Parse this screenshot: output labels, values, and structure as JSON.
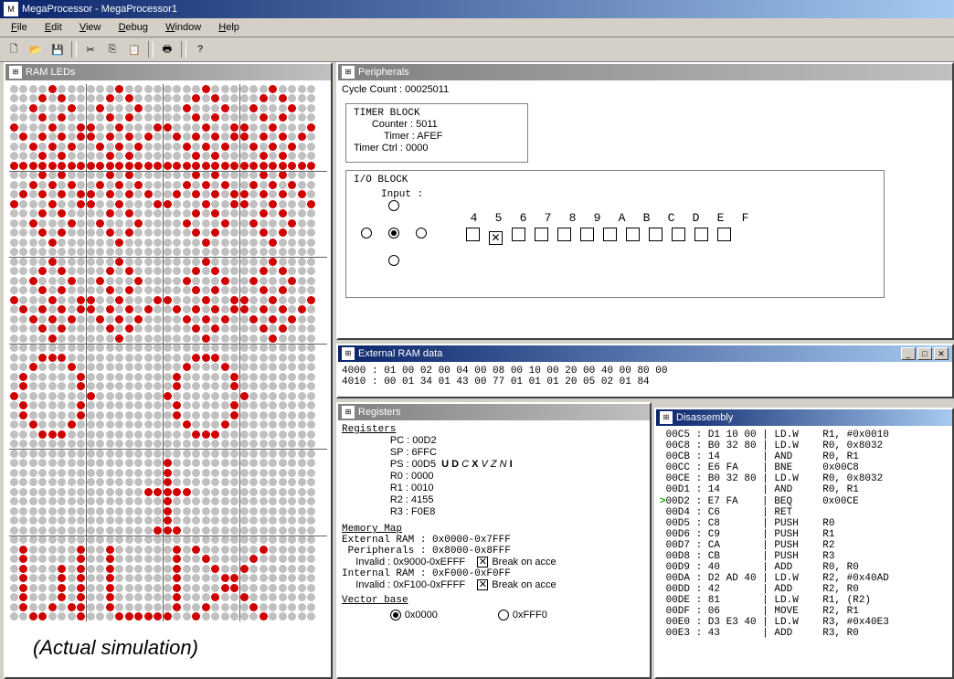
{
  "title": "MegaProcessor - MegaProcessor1",
  "menu": [
    "File",
    "Edit",
    "View",
    "Debug",
    "Window",
    "Help"
  ],
  "panels": {
    "ramleds": "RAM LEDs",
    "peripherals": "Peripherals",
    "extram": "External RAM data",
    "registers": "Registers",
    "disasm": "Disassembly"
  },
  "caption": "(Actual simulation)",
  "peripherals": {
    "cycle_label": "Cycle Count : ",
    "cycle_value": "00025011",
    "timer_block_title": "TIMER BLOCK",
    "counter_label": "Counter : ",
    "counter_value": "5011",
    "timer_label": "Timer : ",
    "timer_value": "AFEF",
    "timerctrl_label": "Timer Ctrl : ",
    "timerctrl_value": "0000",
    "io_block_title": "I/O BLOCK",
    "input_label": "Input : ",
    "bit_labels": [
      "4",
      "5",
      "6",
      "7",
      "8",
      "9",
      "A",
      "B",
      "C",
      "D",
      "E",
      "F"
    ],
    "bit_checked_index": 1
  },
  "extram": {
    "line1": "4000 : 01 00 02 00 04 00 08 00 10 00 20 00 40 00 80 00",
    "line2": "4010 : 00 01 34 01 43 00 77 01 01 01 20 05 02 01 84"
  },
  "registers": {
    "heading": "Registers",
    "pc": "PC : 00D2",
    "sp": "SP : 6FFC",
    "ps": "PS : 00D5  ",
    "flags": "U D C X V Z N I",
    "flags_bold": [
      0,
      1,
      3,
      7
    ],
    "r0": "R0 : 0000",
    "r1": "R1 : 0010",
    "r2": "R2 : 4155",
    "r3": "R3 : F0E8",
    "memmap_heading": "Memory Map",
    "extram": "External RAM : 0x0000-0x7FFF",
    "periph": " Peripherals : 0x8000-0x8FFF",
    "inval1": "     Invalid : 0x9000-0xEFFF",
    "intram": "Internal RAM : 0xF000-0xF0FF",
    "inval2": "     Invalid : 0xF100-0xFFFF",
    "break1": "Break on acce",
    "break2": "Break on acce",
    "vecbase": "Vector base",
    "vb_opt1": "0x0000",
    "vb_opt2": "0xFFF0"
  },
  "disasm": {
    "lines": [
      {
        "a": "00C5",
        "b": "D1 10 00",
        "op": "LD.W",
        "args": "R1, #0x0010"
      },
      {
        "a": "00C8",
        "b": "B0 32 80",
        "op": "LD.W",
        "args": "R0, 0x8032"
      },
      {
        "a": "00CB",
        "b": "14",
        "op": "AND",
        "args": "R0, R1"
      },
      {
        "a": "00CC",
        "b": "E6 FA",
        "op": "BNE",
        "args": "0x00C8"
      },
      {
        "a": "00CE",
        "b": "B0 32 80",
        "op": "LD.W",
        "args": "R0, 0x8032"
      },
      {
        "a": "00D1",
        "b": "14",
        "op": "AND",
        "args": "R0, R1"
      },
      {
        "a": "00D2",
        "b": "E7 FA",
        "op": "BEQ",
        "args": "0x00CE",
        "cur": true
      },
      {
        "a": "00D4",
        "b": "C6",
        "op": "RET",
        "args": ""
      },
      {
        "a": "00D5",
        "b": "C8",
        "op": "PUSH",
        "args": "R0"
      },
      {
        "a": "00D6",
        "b": "C9",
        "op": "PUSH",
        "args": "R1"
      },
      {
        "a": "00D7",
        "b": "CA",
        "op": "PUSH",
        "args": "R2"
      },
      {
        "a": "00D8",
        "b": "CB",
        "op": "PUSH",
        "args": "R3"
      },
      {
        "a": "00D9",
        "b": "40",
        "op": "ADD",
        "args": "R0, R0"
      },
      {
        "a": "00DA",
        "b": "D2 AD 40",
        "op": "LD.W",
        "args": "R2, #0x40AD"
      },
      {
        "a": "00DD",
        "b": "42",
        "op": "ADD",
        "args": "R2, R0"
      },
      {
        "a": "00DE",
        "b": "81",
        "op": "LD.W",
        "args": "R1, (R2)"
      },
      {
        "a": "00DF",
        "b": "06",
        "op": "MOVE",
        "args": "R2, R1"
      },
      {
        "a": "00E0",
        "b": "D3 E3 40",
        "op": "LD.W",
        "args": "R3, #0x40E3"
      },
      {
        "a": "00E3",
        "b": "43",
        "op": "ADD",
        "args": "R3, R0"
      }
    ]
  },
  "leds_on": [
    [
      0,
      4
    ],
    [
      0,
      11
    ],
    [
      0,
      20
    ],
    [
      0,
      27
    ],
    [
      1,
      3
    ],
    [
      1,
      5
    ],
    [
      1,
      10
    ],
    [
      1,
      12
    ],
    [
      1,
      19
    ],
    [
      1,
      21
    ],
    [
      1,
      26
    ],
    [
      1,
      28
    ],
    [
      2,
      2
    ],
    [
      2,
      6
    ],
    [
      2,
      9
    ],
    [
      2,
      13
    ],
    [
      2,
      18
    ],
    [
      2,
      22
    ],
    [
      2,
      25
    ],
    [
      2,
      29
    ],
    [
      3,
      3
    ],
    [
      3,
      5
    ],
    [
      3,
      10
    ],
    [
      3,
      12
    ],
    [
      3,
      19
    ],
    [
      3,
      21
    ],
    [
      3,
      26
    ],
    [
      3,
      28
    ],
    [
      4,
      0
    ],
    [
      4,
      4
    ],
    [
      4,
      7
    ],
    [
      4,
      8
    ],
    [
      4,
      11
    ],
    [
      4,
      15
    ],
    [
      4,
      16
    ],
    [
      4,
      20
    ],
    [
      4,
      23
    ],
    [
      4,
      24
    ],
    [
      4,
      27
    ],
    [
      4,
      31
    ],
    [
      5,
      1
    ],
    [
      5,
      3
    ],
    [
      5,
      5
    ],
    [
      5,
      7
    ],
    [
      5,
      8
    ],
    [
      5,
      10
    ],
    [
      5,
      12
    ],
    [
      5,
      14
    ],
    [
      5,
      17
    ],
    [
      5,
      19
    ],
    [
      5,
      21
    ],
    [
      5,
      23
    ],
    [
      5,
      24
    ],
    [
      5,
      26
    ],
    [
      5,
      28
    ],
    [
      5,
      30
    ],
    [
      6,
      2
    ],
    [
      6,
      4
    ],
    [
      6,
      6
    ],
    [
      6,
      9
    ],
    [
      6,
      11
    ],
    [
      6,
      13
    ],
    [
      6,
      18
    ],
    [
      6,
      20
    ],
    [
      6,
      22
    ],
    [
      6,
      25
    ],
    [
      6,
      27
    ],
    [
      6,
      29
    ],
    [
      7,
      3
    ],
    [
      7,
      5
    ],
    [
      7,
      10
    ],
    [
      7,
      12
    ],
    [
      7,
      19
    ],
    [
      7,
      21
    ],
    [
      7,
      26
    ],
    [
      7,
      28
    ],
    [
      8,
      0
    ],
    [
      8,
      1
    ],
    [
      8,
      2
    ],
    [
      8,
      3
    ],
    [
      8,
      4
    ],
    [
      8,
      5
    ],
    [
      8,
      6
    ],
    [
      8,
      7
    ],
    [
      8,
      8
    ],
    [
      8,
      9
    ],
    [
      8,
      10
    ],
    [
      8,
      11
    ],
    [
      8,
      12
    ],
    [
      8,
      13
    ],
    [
      8,
      14
    ],
    [
      8,
      15
    ],
    [
      8,
      16
    ],
    [
      8,
      17
    ],
    [
      8,
      18
    ],
    [
      8,
      19
    ],
    [
      8,
      20
    ],
    [
      8,
      21
    ],
    [
      8,
      22
    ],
    [
      8,
      23
    ],
    [
      8,
      24
    ],
    [
      8,
      25
    ],
    [
      8,
      26
    ],
    [
      8,
      27
    ],
    [
      8,
      28
    ],
    [
      8,
      29
    ],
    [
      8,
      30
    ],
    [
      8,
      31
    ],
    [
      9,
      3
    ],
    [
      9,
      5
    ],
    [
      9,
      10
    ],
    [
      9,
      12
    ],
    [
      9,
      19
    ],
    [
      9,
      21
    ],
    [
      9,
      26
    ],
    [
      9,
      28
    ],
    [
      10,
      2
    ],
    [
      10,
      4
    ],
    [
      10,
      6
    ],
    [
      10,
      9
    ],
    [
      10,
      11
    ],
    [
      10,
      13
    ],
    [
      10,
      18
    ],
    [
      10,
      20
    ],
    [
      10,
      22
    ],
    [
      10,
      25
    ],
    [
      10,
      27
    ],
    [
      10,
      29
    ],
    [
      11,
      1
    ],
    [
      11,
      3
    ],
    [
      11,
      5
    ],
    [
      11,
      7
    ],
    [
      11,
      8
    ],
    [
      11,
      10
    ],
    [
      11,
      12
    ],
    [
      11,
      14
    ],
    [
      11,
      17
    ],
    [
      11,
      19
    ],
    [
      11,
      21
    ],
    [
      11,
      23
    ],
    [
      11,
      24
    ],
    [
      11,
      26
    ],
    [
      11,
      28
    ],
    [
      11,
      30
    ],
    [
      12,
      0
    ],
    [
      12,
      4
    ],
    [
      12,
      7
    ],
    [
      12,
      8
    ],
    [
      12,
      11
    ],
    [
      12,
      15
    ],
    [
      12,
      16
    ],
    [
      12,
      20
    ],
    [
      12,
      23
    ],
    [
      12,
      24
    ],
    [
      12,
      27
    ],
    [
      12,
      31
    ],
    [
      13,
      3
    ],
    [
      13,
      5
    ],
    [
      13,
      10
    ],
    [
      13,
      12
    ],
    [
      13,
      19
    ],
    [
      13,
      21
    ],
    [
      13,
      26
    ],
    [
      13,
      28
    ],
    [
      14,
      2
    ],
    [
      14,
      6
    ],
    [
      14,
      9
    ],
    [
      14,
      13
    ],
    [
      14,
      18
    ],
    [
      14,
      22
    ],
    [
      14,
      25
    ],
    [
      14,
      29
    ],
    [
      15,
      3
    ],
    [
      15,
      5
    ],
    [
      15,
      10
    ],
    [
      15,
      12
    ],
    [
      15,
      19
    ],
    [
      15,
      21
    ],
    [
      15,
      26
    ],
    [
      15,
      28
    ],
    [
      16,
      4
    ],
    [
      16,
      11
    ],
    [
      16,
      20
    ],
    [
      16,
      27
    ],
    [
      18,
      4
    ],
    [
      18,
      11
    ],
    [
      18,
      20
    ],
    [
      18,
      27
    ],
    [
      19,
      3
    ],
    [
      19,
      5
    ],
    [
      19,
      10
    ],
    [
      19,
      12
    ],
    [
      19,
      19
    ],
    [
      19,
      21
    ],
    [
      19,
      26
    ],
    [
      19,
      28
    ],
    [
      20,
      2
    ],
    [
      20,
      6
    ],
    [
      20,
      9
    ],
    [
      20,
      13
    ],
    [
      20,
      18
    ],
    [
      20,
      22
    ],
    [
      20,
      25
    ],
    [
      20,
      29
    ],
    [
      21,
      3
    ],
    [
      21,
      5
    ],
    [
      21,
      10
    ],
    [
      21,
      12
    ],
    [
      21,
      19
    ],
    [
      21,
      21
    ],
    [
      21,
      26
    ],
    [
      21,
      28
    ],
    [
      22,
      0
    ],
    [
      22,
      4
    ],
    [
      22,
      7
    ],
    [
      22,
      8
    ],
    [
      22,
      11
    ],
    [
      22,
      15
    ],
    [
      22,
      16
    ],
    [
      22,
      20
    ],
    [
      22,
      23
    ],
    [
      22,
      24
    ],
    [
      22,
      27
    ],
    [
      22,
      31
    ],
    [
      23,
      1
    ],
    [
      23,
      3
    ],
    [
      23,
      5
    ],
    [
      23,
      7
    ],
    [
      23,
      8
    ],
    [
      23,
      10
    ],
    [
      23,
      12
    ],
    [
      23,
      14
    ],
    [
      23,
      17
    ],
    [
      23,
      19
    ],
    [
      23,
      21
    ],
    [
      23,
      23
    ],
    [
      23,
      24
    ],
    [
      23,
      26
    ],
    [
      23,
      28
    ],
    [
      23,
      30
    ],
    [
      24,
      2
    ],
    [
      24,
      4
    ],
    [
      24,
      6
    ],
    [
      24,
      9
    ],
    [
      24,
      11
    ],
    [
      24,
      13
    ],
    [
      24,
      18
    ],
    [
      24,
      20
    ],
    [
      24,
      22
    ],
    [
      24,
      25
    ],
    [
      24,
      27
    ],
    [
      24,
      29
    ],
    [
      25,
      3
    ],
    [
      25,
      5
    ],
    [
      25,
      10
    ],
    [
      25,
      12
    ],
    [
      25,
      19
    ],
    [
      25,
      21
    ],
    [
      25,
      26
    ],
    [
      25,
      28
    ],
    [
      26,
      4
    ],
    [
      26,
      11
    ],
    [
      26,
      20
    ],
    [
      26,
      27
    ],
    [
      28,
      3
    ],
    [
      28,
      4
    ],
    [
      28,
      5
    ],
    [
      28,
      19
    ],
    [
      28,
      20
    ],
    [
      28,
      21
    ],
    [
      29,
      2
    ],
    [
      29,
      6
    ],
    [
      29,
      18
    ],
    [
      29,
      22
    ],
    [
      30,
      1
    ],
    [
      30,
      7
    ],
    [
      30,
      17
    ],
    [
      30,
      23
    ],
    [
      31,
      1
    ],
    [
      31,
      7
    ],
    [
      31,
      17
    ],
    [
      31,
      23
    ],
    [
      32,
      0
    ],
    [
      32,
      8
    ],
    [
      32,
      16
    ],
    [
      32,
      24
    ],
    [
      33,
      1
    ],
    [
      33,
      7
    ],
    [
      33,
      17
    ],
    [
      33,
      23
    ],
    [
      34,
      1
    ],
    [
      34,
      7
    ],
    [
      34,
      17
    ],
    [
      34,
      23
    ],
    [
      35,
      2
    ],
    [
      35,
      6
    ],
    [
      35,
      18
    ],
    [
      35,
      22
    ],
    [
      36,
      3
    ],
    [
      36,
      4
    ],
    [
      36,
      5
    ],
    [
      36,
      19
    ],
    [
      36,
      20
    ],
    [
      36,
      21
    ],
    [
      39,
      16
    ],
    [
      40,
      16
    ],
    [
      41,
      16
    ],
    [
      42,
      14
    ],
    [
      42,
      15
    ],
    [
      42,
      16
    ],
    [
      42,
      17
    ],
    [
      42,
      18
    ],
    [
      43,
      16
    ],
    [
      44,
      16
    ],
    [
      45,
      16
    ],
    [
      46,
      15
    ],
    [
      46,
      16
    ],
    [
      46,
      17
    ],
    [
      48,
      1
    ],
    [
      48,
      7
    ],
    [
      48,
      10
    ],
    [
      48,
      17
    ],
    [
      48,
      19
    ],
    [
      48,
      26
    ],
    [
      49,
      1
    ],
    [
      49,
      7
    ],
    [
      49,
      10
    ],
    [
      49,
      17
    ],
    [
      49,
      20
    ],
    [
      49,
      25
    ],
    [
      50,
      1
    ],
    [
      50,
      5
    ],
    [
      50,
      7
    ],
    [
      50,
      10
    ],
    [
      50,
      17
    ],
    [
      50,
      21
    ],
    [
      50,
      24
    ],
    [
      51,
      1
    ],
    [
      51,
      5
    ],
    [
      51,
      7
    ],
    [
      51,
      10
    ],
    [
      51,
      17
    ],
    [
      51,
      22
    ],
    [
      51,
      23
    ],
    [
      52,
      1
    ],
    [
      52,
      5
    ],
    [
      52,
      7
    ],
    [
      52,
      10
    ],
    [
      52,
      17
    ],
    [
      52,
      22
    ],
    [
      52,
      23
    ],
    [
      53,
      1
    ],
    [
      53,
      5
    ],
    [
      53,
      7
    ],
    [
      53,
      10
    ],
    [
      53,
      17
    ],
    [
      53,
      21
    ],
    [
      53,
      24
    ],
    [
      54,
      1
    ],
    [
      54,
      4
    ],
    [
      54,
      6
    ],
    [
      54,
      7
    ],
    [
      54,
      10
    ],
    [
      54,
      17
    ],
    [
      54,
      20
    ],
    [
      54,
      25
    ],
    [
      55,
      2
    ],
    [
      55,
      3
    ],
    [
      55,
      7
    ],
    [
      55,
      11
    ],
    [
      55,
      12
    ],
    [
      55,
      13
    ],
    [
      55,
      14
    ],
    [
      55,
      15
    ],
    [
      55,
      16
    ],
    [
      55,
      19
    ],
    [
      55,
      26
    ]
  ]
}
